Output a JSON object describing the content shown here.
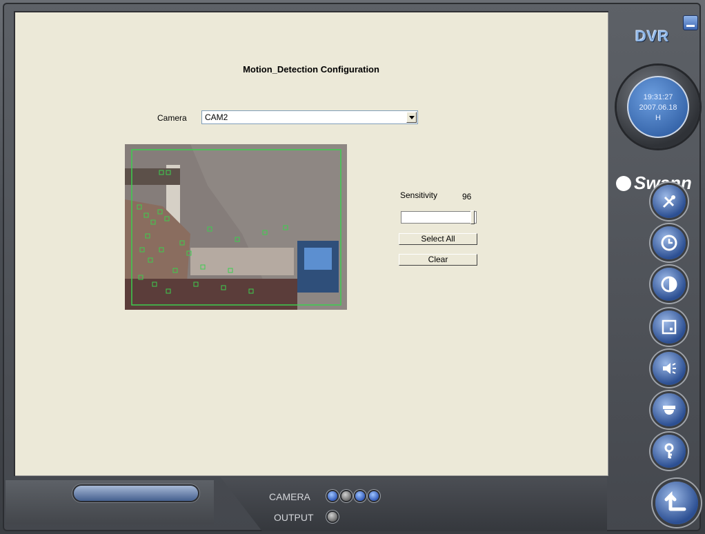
{
  "app": {
    "title": "DVR",
    "brand": "Swann"
  },
  "header": {
    "page_title": "Motion_Detection Configuration"
  },
  "camera": {
    "label": "Camera",
    "selected": "CAM2"
  },
  "sensitivity": {
    "label": "Sensitivity",
    "value": "96",
    "level": 0.96
  },
  "buttons": {
    "select_all": "Select All",
    "clear": "Clear"
  },
  "clock": {
    "time": "19:31:27",
    "date": "2007.06.18",
    "mode": "H"
  },
  "bottom": {
    "camera_label": "CAMERA",
    "output_label": "OUTPUT",
    "camera_indicators": [
      "blue",
      "gray",
      "blue",
      "blue"
    ],
    "output_indicators": [
      "gray"
    ]
  },
  "side_menu": [
    {
      "name": "tools-icon"
    },
    {
      "name": "clock-icon"
    },
    {
      "name": "contrast-icon"
    },
    {
      "name": "display-icon"
    },
    {
      "name": "audio-icon"
    },
    {
      "name": "dome-camera-icon"
    },
    {
      "name": "key-icon"
    }
  ],
  "colors": {
    "panel": "#ece9d8",
    "accent": "#3463a8",
    "motion_grid": "#3ccf4e"
  }
}
